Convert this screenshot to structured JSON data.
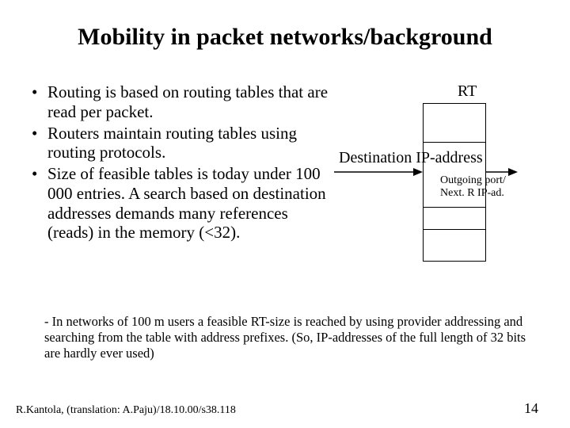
{
  "title": "Mobility in packet networks/background",
  "bullets": [
    "Routing is based on routing tables that are read per packet.",
    "Routers maintain routing tables using routing protocols.",
    "Size of  feasible tables  is today under 100 000 entries. A search based on destination addresses demands many references (reads) in the memory (<32)."
  ],
  "diagram": {
    "rt_label": "RT",
    "dest_label": "Destination IP-address",
    "out_line1": "Outgoing port/",
    "out_line2": "Next. R IP-ad."
  },
  "footnote": "- In networks of 100 m users a feasible RT-size is reached by using provider addressing and searching from the table with address prefixes. (So, IP-addresses of the full length of 32 bits are hardly ever used)",
  "footer": {
    "left": "R.Kantola, (translation: A.Paju)/18.10.00/s38.118",
    "right": "14"
  }
}
